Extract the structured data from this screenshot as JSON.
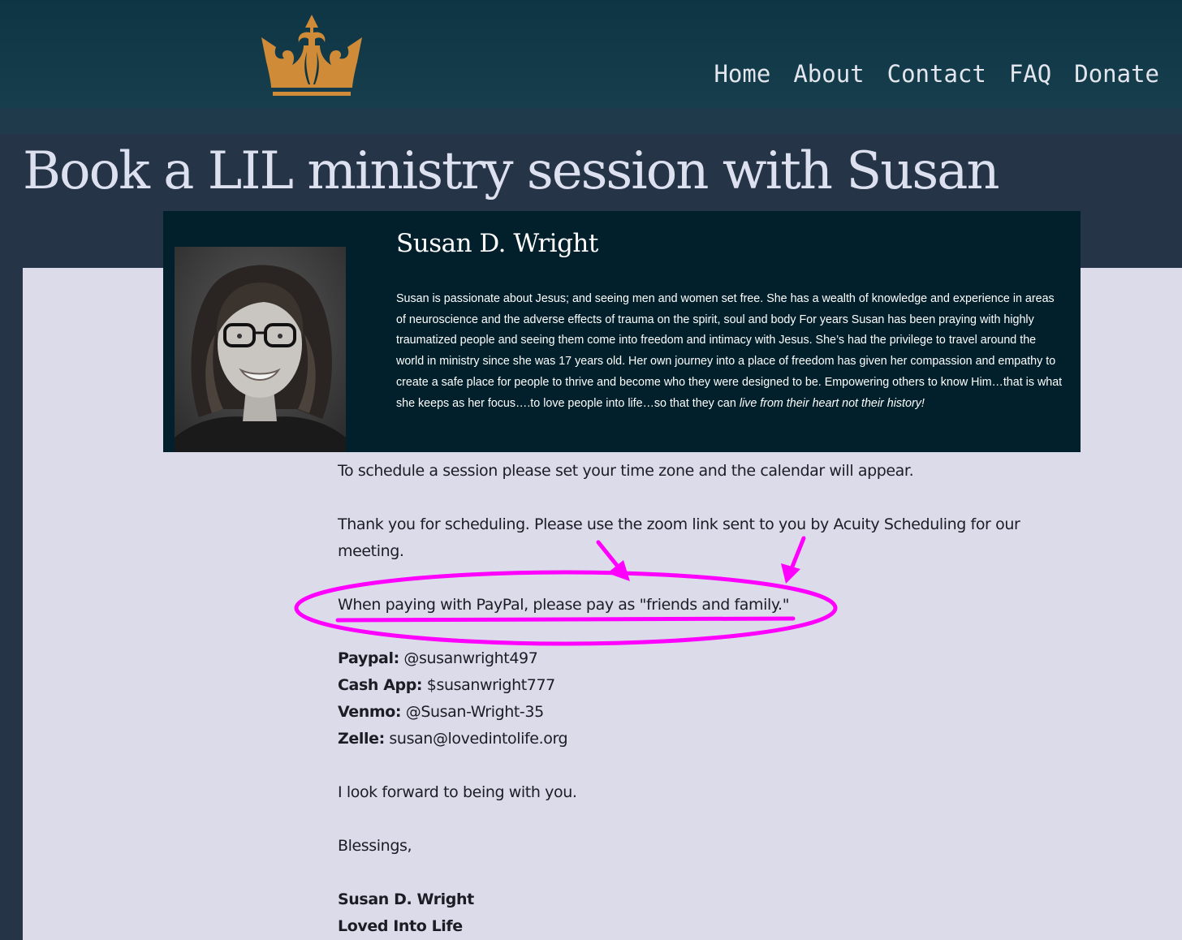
{
  "nav": {
    "items": [
      "Home",
      "About",
      "Contact",
      "FAQ",
      "Donate"
    ]
  },
  "page": {
    "title": "Book a LIL ministry session with Susan"
  },
  "bio": {
    "name": "Susan D. Wright",
    "text": "Susan is passionate about Jesus; and seeing men and women set free. She has a wealth of knowledge and experience in areas of neuroscience and the adverse effects of trauma on the spirit, soul and body For years Susan has been praying with highly traumatized people and seeing them come into freedom and intimacy with Jesus. She’s had the privilege to travel around the world in ministry since she was 17 years old. Her own journey into a place of freedom has given her compassion and empathy to create a safe place for people to thrive and become who they were designed to be. Empowering others to know Him…that is what she keeps as her focus….to love people into life…so that they can ",
    "text_italic": "live from their heart not their history!"
  },
  "body": {
    "schedule_text": "To schedule a session please set your time zone and the calendar will appear.",
    "thanks_text": "Thank you for scheduling. Please use the zoom link sent to you by Acuity Scheduling for our meeting.",
    "paypal_note": "When paying with PayPal, please pay as \"friends and family.\"",
    "payments": [
      {
        "label": "Paypal:",
        "value": "@susanwright497"
      },
      {
        "label": "Cash App:",
        "value": "$susanwright777"
      },
      {
        "label": "Venmo:",
        "value": "@Susan-Wright-35"
      },
      {
        "label": "Zelle:",
        "value": "susan@lovedintolife.org"
      }
    ],
    "closing": "I look forward to being with you.",
    "blessings": "Blessings,",
    "signature_name": "Susan D. Wright",
    "signature_org": "Loved Into Life"
  },
  "colors": {
    "header": "#0d3544",
    "gold": "#d08b38",
    "card": "#01202b",
    "content": "#dcdbea",
    "annotation": "#ff00ff"
  }
}
